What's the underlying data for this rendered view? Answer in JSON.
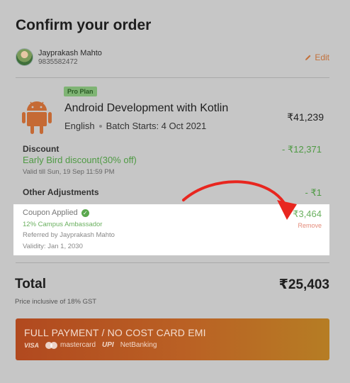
{
  "page": {
    "title": "Confirm your order"
  },
  "user": {
    "name": "Jayprakash Mahto",
    "phone": "9835582472",
    "edit_label": "Edit"
  },
  "course": {
    "plan_badge": "Pro Plan",
    "title": "Android Development with Kotlin",
    "language": "English",
    "batch": "Batch Starts: 4 Oct 2021",
    "price": "₹41,239"
  },
  "discount": {
    "label": "Discount",
    "name": "Early Bird discount(30% off)",
    "validity": "Valid till Sun, 19 Sep 11:59 PM",
    "value": "- ₹12,371"
  },
  "adjustments": {
    "label": "Other Adjustments",
    "value": "- ₹1"
  },
  "coupon": {
    "label": "Coupon Applied",
    "name": "12% Campus Ambassador",
    "referred": "Referred by Jayprakash Mahto",
    "validity": "Validity: Jan 1, 2030",
    "value": "- ₹3,464",
    "remove_label": "Remove"
  },
  "total": {
    "label": "Total",
    "value": "₹25,403",
    "note": "Price inclusive of 18% GST"
  },
  "payment": {
    "label": "FULL PAYMENT / NO COST CARD EMI",
    "methods": {
      "visa": "VISA",
      "mastercard": "mastercard",
      "upi": "UPI",
      "netbanking": "NetBanking"
    }
  },
  "colors": {
    "accent": "#c2703a",
    "discount_green": "#4f9a44",
    "arrow_red": "#e8261f",
    "button_start": "#b1491f",
    "button_end": "#b67d24"
  },
  "icons": [
    "user-avatar",
    "pencil-icon",
    "android-icon",
    "check-circle-icon",
    "curved-arrow",
    "mastercard-logo"
  ]
}
